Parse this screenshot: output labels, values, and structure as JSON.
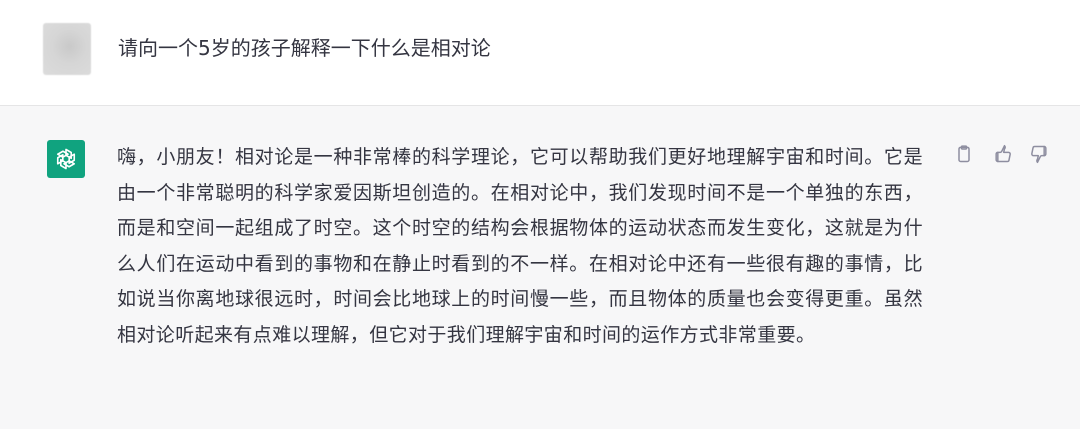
{
  "user_message": {
    "text": "请向一个5岁的孩子解释一下什么是相对论"
  },
  "assistant_message": {
    "text": "嗨，小朋友！相对论是一种非常棒的科学理论，它可以帮助我们更好地理解宇宙和时间。它是由一个非常聪明的科学家爱因斯坦创造的。在相对论中，我们发现时间不是一个单独的东西，而是和空间一起组成了时空。这个时空的结构会根据物体的运动状态而发生变化，这就是为什么人们在运动中看到的事物和在静止时看到的不一样。在相对论中还有一些很有趣的事情，比如说当你离地球很远时，时间会比地球上的时间慢一些，而且物体的质量也会变得更重。虽然相对论听起来有点难以理解，但它对于我们理解宇宙和时间的运作方式非常重要。"
  },
  "icons": {
    "bot_avatar": "openai-logo-icon",
    "copy": "clipboard-icon",
    "like": "thumbs-up-icon",
    "dislike": "thumbs-down-icon"
  },
  "colors": {
    "bot_avatar_bg": "#10a37f",
    "assistant_bg": "#f7f7f8",
    "text": "#343541",
    "icon": "#8e8ea0"
  }
}
